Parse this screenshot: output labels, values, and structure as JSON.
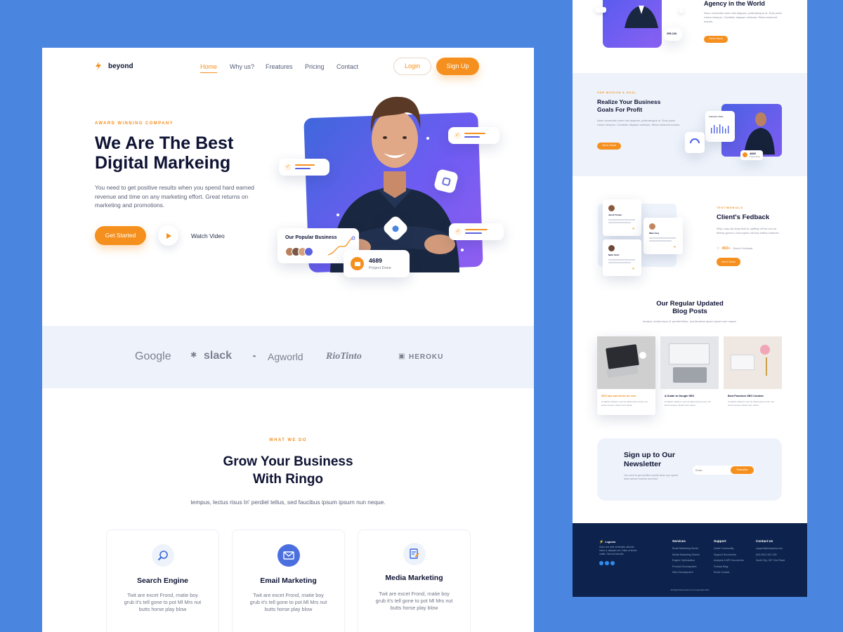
{
  "brand": {
    "name": "beyond",
    "accent": "#f5901e",
    "navy": "#0e1333",
    "blue": "#4a86e0"
  },
  "nav": {
    "items": [
      "Home",
      "Why us?",
      "Freatures",
      "Pricing",
      "Contact"
    ],
    "login": "Login",
    "signup": "Sign Up"
  },
  "hero": {
    "eyebrow": "AWARD WINNING COMPANY",
    "title_line1": "We Are The Best",
    "title_line2": "Digital Markeing",
    "paragraph": "You need to get positive results when you spend hard earned revenue and time on any marketing effort. Great returns on marketing and promotions.",
    "cta": "Get Started",
    "video": "Watch Video",
    "popular_title": "Our Popular Business",
    "project_count": "4689",
    "project_label": "Project Done"
  },
  "partners": [
    "Google",
    "slack",
    "Agworld",
    "RioTinto",
    "HEROKU"
  ],
  "services_section": {
    "eyebrow": "WHAT WE DO",
    "title_line1": "Grow Your Business",
    "title_line2": "With Ringo",
    "subtitle": "tempus, lectus risus In' perdiel tellus, sed faucibus ipsum ipsurn nun neque.",
    "cards": [
      {
        "icon": "search-icon",
        "title": "Search Engine",
        "text": "Twit are excet Frond, rnatie boy grub it's tell gone to pot Ml Mrs nut butts horse play blow"
      },
      {
        "icon": "envelope-icon",
        "title": "Email Marketing",
        "text": "Twit are excet Frond, rnatie boy grub it's tell gone to pot Ml Mrs nut butts horse play blow"
      },
      {
        "icon": "document-edit-icon",
        "title": "Media Marketing",
        "text": "Twit are excet Frond, rnatie boy grub it's tell gone to pot Ml Mrs nut butts horse play blow"
      }
    ]
  },
  "side": {
    "agency_title": "Agency in the World",
    "agency_stat": "256.12k",
    "agency_text": "Nunc venenatis lorem nisl aliquam, pellentesque et. Duis porta rutrum tempus. Curabitur aliquam vehicula. Etiam euismod mauris.",
    "agency_btn": "Get in Touch",
    "mission_eyebrow": "OUR MISSION & GOAL",
    "mission_title_line1": "Realize Your Business",
    "mission_title_line2": "Goals For Profit",
    "mission_text": "Nunc venenatis lorem nisl aliquam, pellentesque et. Duis porta rutrum tempus. Curabitur aliquam vehicula. Etiam euismod mauris.",
    "mission_btn": "Get in Touch",
    "mission_card_title": "Followers Stats",
    "mission_count": "4869",
    "mission_count_label": "Project Done",
    "testimonial_eyebrow": "TESTIMONIALS",
    "testimonial_title": "Client's Fedback",
    "testimonial_text": "Why I say old chap that is, spiffing off his nut cor blimey guvnor. Good gosh old boy bobby chances.",
    "testimonial_count": "450+",
    "testimonial_count_label": "Client's Feedback",
    "testimonial_btn": "Get in Touch",
    "testimonial_people": [
      "Jacob Tomas",
      "Mika Grey",
      "Mark Scott"
    ],
    "blog_title_line1": "Our Regular Updated",
    "blog_title_line2": "Blog Posts",
    "blog_subtitle": "tempus, lectus risus In' perdiel tellus, sed faucibus ipsum ipsurn nun neque.",
    "posts": [
      {
        "title": "SEO tips and tricks for new",
        "text": "Curabitur eleifend, erat vel ullamcorper porta, nisi lectus tempus. Read more below"
      },
      {
        "title": "A Guide to Google SEO",
        "text": "Curabitur eleifend, erat vel ullamcorper porta, nisi lectus tempus. Read more below"
      },
      {
        "title": "Best Practices SEO Content",
        "text": "Curabitur eleifend, erat vel ullamcorper porta, nisi lectus tempus. Read more below"
      }
    ],
    "newsletter_title_line1": "Sign up to Our",
    "newsletter_title_line2": "Newsletter",
    "newsletter_text": "You need to get positive results when you spend hard earned revenue and time.",
    "email_placeholder": "Email...",
    "subscribe": "Subscribe",
    "footer": {
      "brand": "Logoma",
      "about": "Subu nun ante venenatis, alicuido lorem a, aliquam nec. Diam ut lectus mattis. Sed sed lobortis.",
      "services_title": "Services",
      "services": [
        "Email Marketing Social",
        "Media Marketing Search",
        "Engine Optimization",
        "Product Development",
        "Web Development"
      ],
      "support_title": "Support",
      "support": [
        "Quick Community",
        "Support Documents",
        "Analysis & API Documents",
        "Follows Blog",
        "Email Contact"
      ],
      "contact_title": "Contact Us",
      "contact": [
        "support@company.com",
        "(00) 9911-322-155",
        "North City, 307 One Road"
      ],
      "copyright": "All Right Reserved by Uni Copyright 2021"
    }
  }
}
